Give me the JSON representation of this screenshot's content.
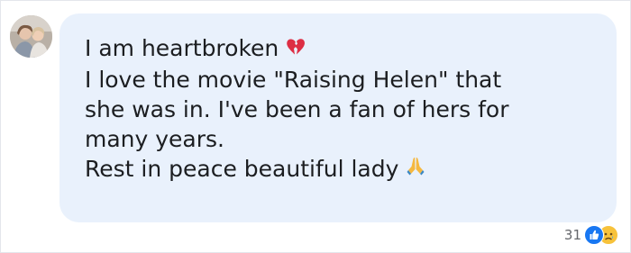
{
  "comment": {
    "lines": [
      "I am heartbroken",
      "I love the movie \"Raising Helen\" that",
      "she was in. I've been a fan of hers for",
      "many years.",
      "Rest in peace beautiful lady"
    ],
    "line1_emoji": "broken-heart-emoji",
    "line5_emoji": "folded-hands-emoji"
  },
  "reactions": {
    "count": "31",
    "types": [
      "like-icon",
      "sad-icon"
    ],
    "like_color": "#1877f2",
    "sad_color": "#f7c23b"
  },
  "colors": {
    "bubble": "#e9f1fc",
    "text": "#1c1e21",
    "muted": "#65676b"
  }
}
